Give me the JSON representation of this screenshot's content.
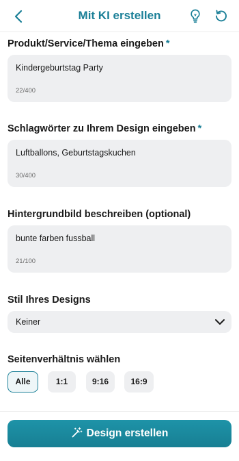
{
  "header": {
    "title": "Mit KI erstellen"
  },
  "form": {
    "product": {
      "label": "Produkt/Service/Thema eingeben",
      "required_marker": "*",
      "value": "Kindergeburtstag Party",
      "counter": "22/400"
    },
    "keywords": {
      "label": "Schlagwörter zu Ihrem Design eingeben",
      "required_marker": "*",
      "value": "Luftballons, Geburtstagskuchen",
      "counter": "30/400"
    },
    "background": {
      "label": "Hintergrundbild beschreiben (optional)",
      "value": "bunte farben fussball",
      "counter": "21/100"
    },
    "style": {
      "label": "Stil Ihres Designs",
      "selected": "Keiner"
    },
    "aspect_ratio": {
      "label": "Seitenverhältnis wählen",
      "options": [
        "Alle",
        "1:1",
        "9:16",
        "16:9"
      ],
      "selected": "Alle"
    }
  },
  "actions": {
    "create_label": "Design erstellen"
  },
  "colors": {
    "accent": "#1a7f97",
    "field_bg": "#eeeff1"
  },
  "icons": {
    "back": "chevron-left-icon",
    "tips": "lightbulb-icon",
    "reset": "rotate-ccw-icon",
    "dropdown": "chevron-down-icon",
    "create": "magic-wand-icon"
  }
}
